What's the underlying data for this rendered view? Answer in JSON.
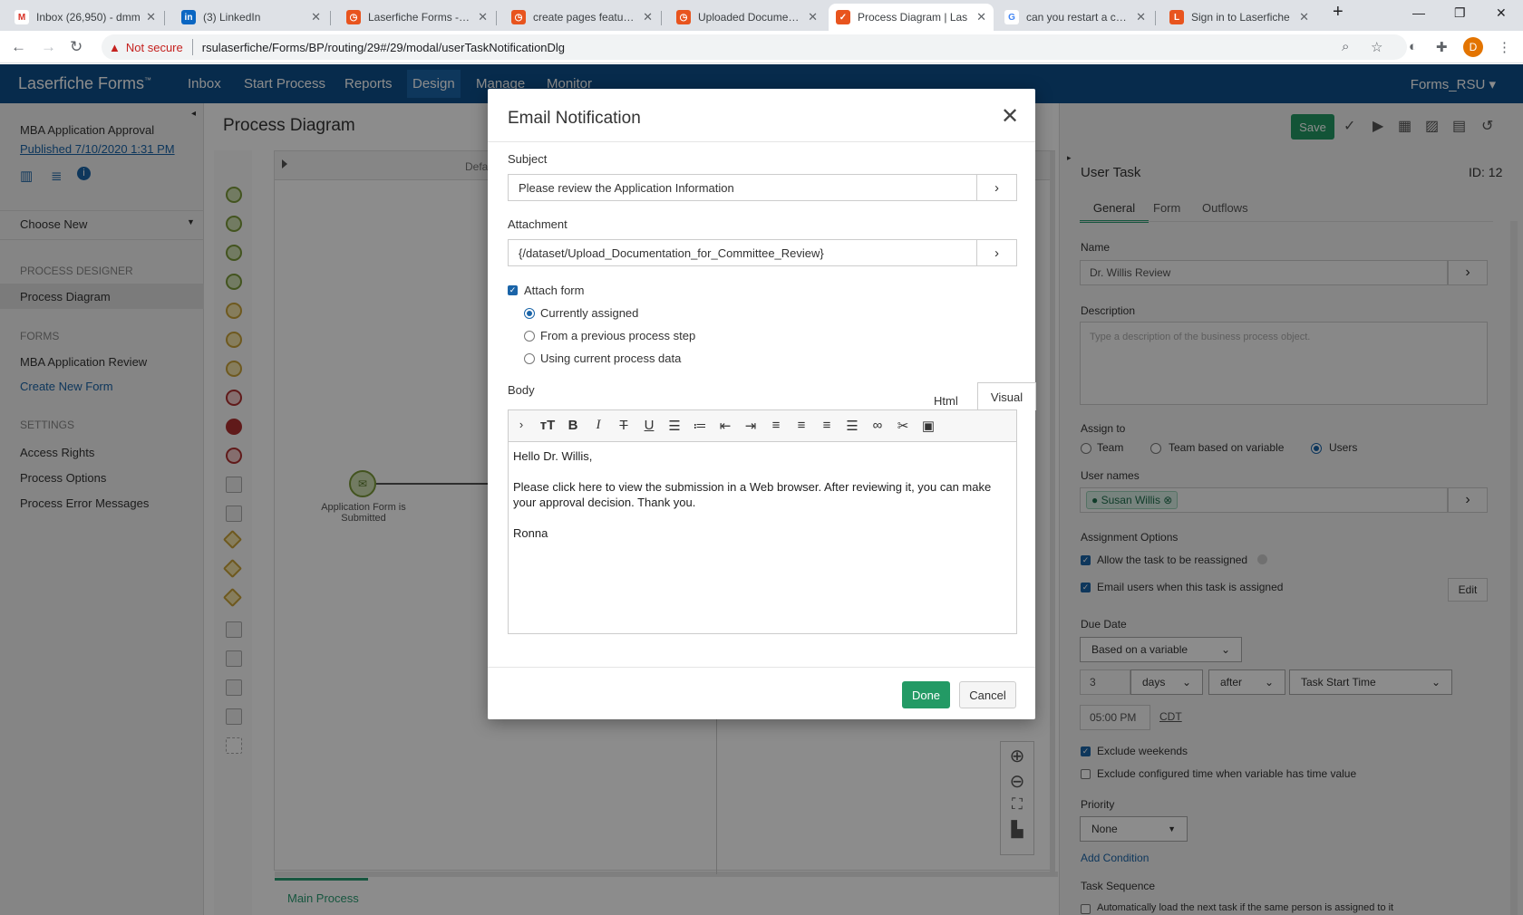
{
  "browser": {
    "tabs": [
      {
        "title": "Inbox (26,950) - dmm",
        "icon": "gmail-icon",
        "color": "#d93025"
      },
      {
        "title": "(3) LinkedIn",
        "icon": "linkedin-icon",
        "color": "#0a66c2"
      },
      {
        "title": "Laserfiche Forms - Up",
        "icon": "laserfiche-icon",
        "color": "#e8541e"
      },
      {
        "title": "create pages feature i",
        "icon": "laserfiche-icon",
        "color": "#e8541e"
      },
      {
        "title": "Uploaded Documents",
        "icon": "laserfiche-icon",
        "color": "#e8541e"
      },
      {
        "title": "Process Diagram | Las",
        "icon": "check-icon",
        "color": "#e8541e"
      },
      {
        "title": "can you restart a canc",
        "icon": "google-icon",
        "color": "#4285f4"
      },
      {
        "title": "Sign in to Laserfiche",
        "icon": "laserfiche-l-icon",
        "color": "#e8541e"
      }
    ],
    "not_secure": "Not secure",
    "url": "rsulaserfiche/Forms/BP/routing/29#/29/modal/userTaskNotificationDlg",
    "profile_initial": "D"
  },
  "app": {
    "brand": "Laserfiche Forms",
    "brand_tm": "™",
    "nav": [
      "Inbox",
      "Start Process",
      "Reports",
      "Design",
      "Manage",
      "Monitor"
    ],
    "user": "Forms_RSU"
  },
  "sidebar": {
    "process_name": "MBA Application Approval",
    "published": "Published 7/10/2020 1:31 PM",
    "choose_new": "Choose New",
    "h_designer": "PROCESS DESIGNER",
    "process_diagram": "Process Diagram",
    "h_forms": "FORMS",
    "form_name": "MBA Application Review",
    "create_form": "Create New Form",
    "h_settings": "SETTINGS",
    "access_rights": "Access Rights",
    "process_options": "Process Options",
    "error_messages": "Process Error Messages"
  },
  "main": {
    "title": "Process Diagram",
    "lane_label": "Defa",
    "start_event_label": "Application Form is Submitted",
    "main_tab": "Main Process"
  },
  "toolbar": {
    "save": "Save"
  },
  "task": {
    "header": "User Task",
    "id": "ID: 12",
    "tabs": [
      "General",
      "Form",
      "Outflows"
    ],
    "name_label": "Name",
    "name_value": "Dr. Willis Review",
    "desc_label": "Description",
    "desc_placeholder": "Type a description of the business process object.",
    "assign_label": "Assign to",
    "assign_options": [
      "Team",
      "Team based on variable",
      "Users"
    ],
    "user_names_label": "User names",
    "user_chip": "Susan Willis",
    "assign_opts_label": "Assignment Options",
    "allow_reassign": "Allow the task to be reassigned",
    "email_users": "Email users when this task is assigned",
    "edit": "Edit",
    "due_label": "Due Date",
    "due_mode": "Based on a variable",
    "due_num": "3",
    "due_unit": "days",
    "due_rel": "after",
    "due_ref": "Task Start Time",
    "due_time": "05:00 PM",
    "tz": "CDT",
    "exclude_weekends": "Exclude weekends",
    "exclude_time": "Exclude configured time when variable has time value",
    "priority_label": "Priority",
    "priority_value": "None",
    "add_condition": "Add Condition",
    "seq_label": "Task Sequence",
    "seq_text": "Automatically load the next task if the same person is assigned to it"
  },
  "modal": {
    "title": "Email Notification",
    "subject_label": "Subject",
    "subject_value": "Please review the Application Information",
    "attach_label": "Attachment",
    "attach_value": "{/dataset/Upload_Documentation_for_Committee_Review}",
    "attach_form": "Attach form",
    "radio_options": [
      "Currently assigned",
      "From a previous process step",
      "Using current process data"
    ],
    "body_label": "Body",
    "tab_html": "Html",
    "tab_visual": "Visual",
    "body_lines": [
      "Hello Dr. Willis,",
      "Please click here to view the submission in a Web browser. After reviewing it, you can make your approval decision.  Thank you.",
      "Ronna"
    ],
    "done": "Done",
    "cancel": "Cancel"
  }
}
